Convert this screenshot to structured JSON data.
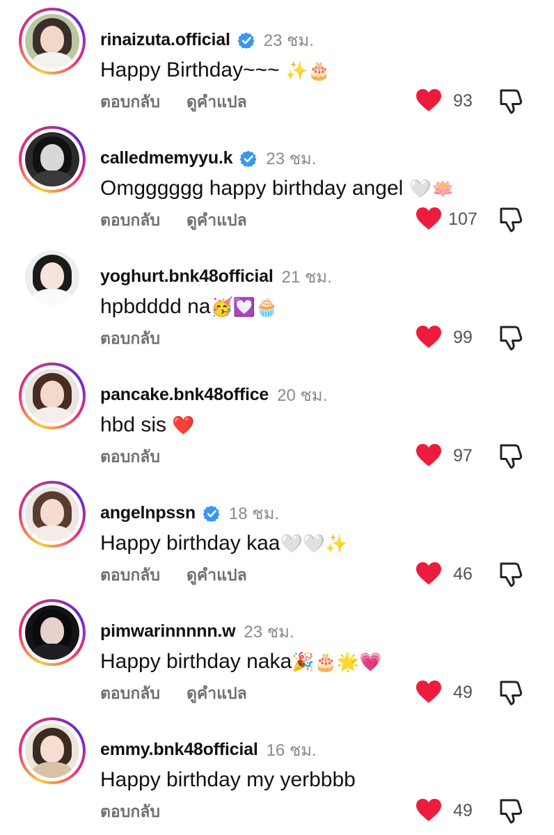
{
  "comments": [
    {
      "username": "rinaizuta.official",
      "verified": true,
      "time": "23 ชม.",
      "text": "Happy Birthday~~~ ",
      "emoji": "✨🎂",
      "reply_label": "ตอบกลับ",
      "translate_label": "ดูคำแปล",
      "likes": "93",
      "ring": true,
      "avatar_colors": {
        "bg": "#b9c7a3",
        "hair": "#3b2e2a",
        "face": "#f1d7c8",
        "body": "#f4f1ee"
      }
    },
    {
      "username": "calledmemyyu.k",
      "verified": true,
      "time": "23 ชม.",
      "text": "Omgggggg happy birthday angel ",
      "emoji": "🤍🪷",
      "reply_label": "ตอบกลับ",
      "translate_label": "ดูคำแปล",
      "likes": "107",
      "ring": true,
      "avatar_colors": {
        "bg": "#2b2b2b",
        "hair": "#111111",
        "face": "#d8d8d8",
        "body": "#3a3a3a"
      }
    },
    {
      "username": "yoghurt.bnk48official",
      "verified": false,
      "time": "21 ชม.",
      "text": "hpbdddd na",
      "emoji": "🥳💟🧁",
      "reply_label": "ตอบกลับ",
      "translate_label": "",
      "likes": "99",
      "ring": false,
      "avatar_colors": {
        "bg": "#eeeeee",
        "hair": "#1a1a1a",
        "face": "#f6e3da",
        "body": "#fafafa"
      }
    },
    {
      "username": "pancake.bnk48office",
      "verified": false,
      "time": "20 ชม.",
      "text": "hbd sis ",
      "emoji": "❤️",
      "reply_label": "ตอบกลับ",
      "translate_label": "",
      "likes": "97",
      "ring": true,
      "avatar_colors": {
        "bg": "#e9e4e0",
        "hair": "#4a2c22",
        "face": "#f3d9cc",
        "body": "#f6eeea"
      }
    },
    {
      "username": "angelnpssn",
      "verified": true,
      "time": "18 ชม.",
      "text": "Happy birthday kaa",
      "emoji": "🤍🤍✨",
      "reply_label": "ตอบกลับ",
      "translate_label": "ดูคำแปล",
      "likes": "46",
      "ring": true,
      "avatar_colors": {
        "bg": "#ede7e3",
        "hair": "#5a3c2e",
        "face": "#f4dccf",
        "body": "#f3ece7"
      }
    },
    {
      "username": "pimwarinnnnn.w",
      "verified": false,
      "time": "23 ชม.",
      "text": "Happy birthday naka",
      "emoji": "🎉🎂🌟💗",
      "reply_label": "ตอบกลับ",
      "translate_label": "ดูคำแปล",
      "likes": "49",
      "ring": true,
      "avatar_colors": {
        "bg": "#141418",
        "hair": "#0b0b0d",
        "face": "#e6d2cb",
        "body": "#1e1e24"
      }
    },
    {
      "username": "emmy.bnk48official",
      "verified": false,
      "time": "16 ชม.",
      "text": "Happy birthday my yerbbbb",
      "emoji": "",
      "reply_label": "ตอบกลับ",
      "translate_label": "",
      "likes": "49",
      "ring": true,
      "avatar_colors": {
        "bg": "#ece5dc",
        "hair": "#3d2a22",
        "face": "#f5ddd0",
        "body": "#d9c3a8"
      }
    }
  ],
  "colors": {
    "verified": "#3897f0",
    "like": "#ed1c3c",
    "muted": "#8a8a8a"
  },
  "icons": {
    "verified": "verified-badge-icon",
    "like": "heart-filled-icon",
    "dislike": "thumbs-down-icon"
  }
}
